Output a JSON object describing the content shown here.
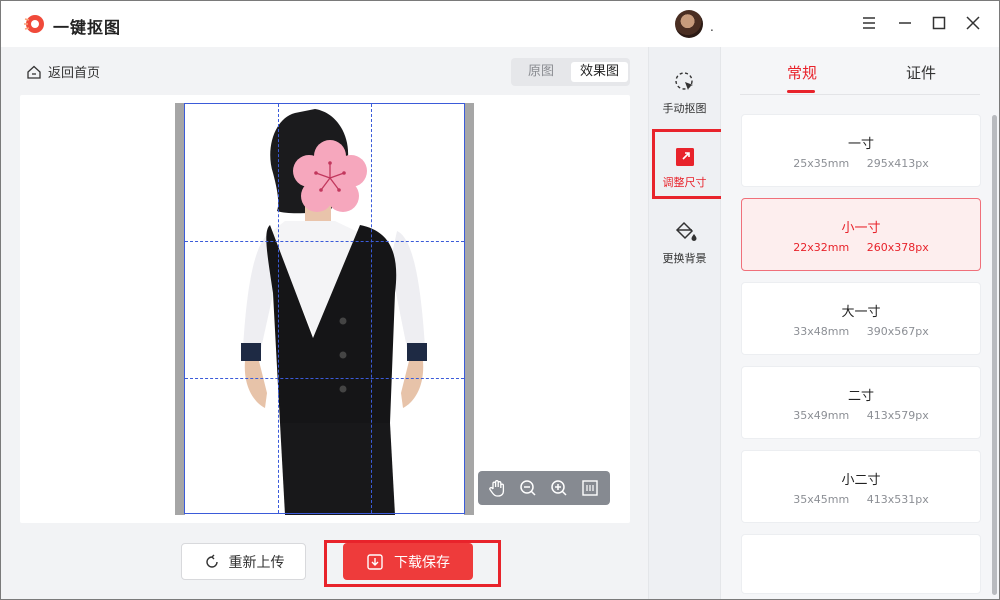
{
  "app": {
    "title": "一键抠图",
    "user_dot": "."
  },
  "nav": {
    "back_label": "返回首页"
  },
  "view_toggle": {
    "original": "原图",
    "result": "效果图",
    "selected": "效果图"
  },
  "actions": {
    "reupload": "重新上传",
    "download": "下载保存"
  },
  "tools": [
    {
      "label": "手动抠图",
      "icon": "cursor-select-icon"
    },
    {
      "label": "调整尺寸",
      "icon": "resize-icon",
      "active": true
    },
    {
      "label": "更换背景",
      "icon": "paint-bucket-icon"
    }
  ],
  "tabs": {
    "regular": "常规",
    "certificate": "证件",
    "selected": "常规"
  },
  "sizes": [
    {
      "name": "一寸",
      "mm": "25x35mm",
      "px": "295x413px"
    },
    {
      "name": "小一寸",
      "mm": "22x32mm",
      "px": "260x378px",
      "selected": true
    },
    {
      "name": "大一寸",
      "mm": "33x48mm",
      "px": "390x567px"
    },
    {
      "name": "二寸",
      "mm": "35x49mm",
      "px": "413x579px"
    },
    {
      "name": "小二寸",
      "mm": "35x45mm",
      "px": "413x531px"
    }
  ],
  "colors": {
    "accent": "#e8232b",
    "download_bg": "#ee3b3b",
    "selected_card_bg": "#fdeeee"
  }
}
